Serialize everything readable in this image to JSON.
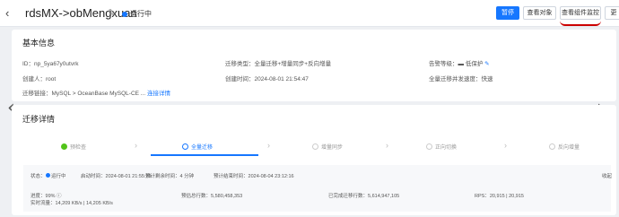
{
  "header": {
    "back_icon": "chevron-left-icon",
    "title": "rdsMX->obMengxuan",
    "status": "运行中",
    "buttons": {
      "pause": "暂停",
      "view_objects": "查看对象",
      "view_monitor": "查看组件监控",
      "more": "更"
    }
  },
  "basic": {
    "heading": "基本信息",
    "id_label": "ID：",
    "id_value": "np_5ya67y0utvrk",
    "type_label": "迁移类型：",
    "type_value": "全量迁移+增量同步+反向增量",
    "alarm_label": "告警等级：",
    "alarm_value": "低保护",
    "creator_label": "创建人：",
    "creator_value": "root",
    "created_label": "创建时间：",
    "created_value": "2024-08-01 21:54:47",
    "concurrency_label": "全量迁移并发速度：",
    "concurrency_value": "快速",
    "link_label": "迁移链接：",
    "link_value": "MySQL  >  OceanBase MySQL-CE ...",
    "link_detail": "连接详情"
  },
  "detail": {
    "heading": "迁移详情",
    "steps": [
      {
        "label": "预检查",
        "state": "done"
      },
      {
        "label": "全量迁移",
        "state": "active"
      },
      {
        "label": "增量同步",
        "state": "todo"
      },
      {
        "label": "正向切换",
        "state": "todo"
      },
      {
        "label": "反向增量",
        "state": "todo"
      }
    ],
    "status_label": "状态：",
    "status_value": "运行中",
    "start_label": "启动时间：",
    "start_value": "2024-08-01 21:55:29",
    "remain_label": "预计剩余时间：",
    "remain_value": "4 分钟",
    "end_label": "预计结束时间：",
    "end_value": "2024-08-04 23:12:16",
    "progress_label": "进度：",
    "progress_value": "99%",
    "total_label": "预估总行数：",
    "total_value": "5,580,458,353",
    "done_label": "已完成迁移行数：",
    "done_value": "5,614,947,105",
    "rps_label": "RPS：",
    "rps_value": "20,915 | 20,915",
    "traffic_label": "实时流量：",
    "traffic_value": "14,209 KB/s | 14,205 KB/s",
    "right_link": "收起"
  }
}
